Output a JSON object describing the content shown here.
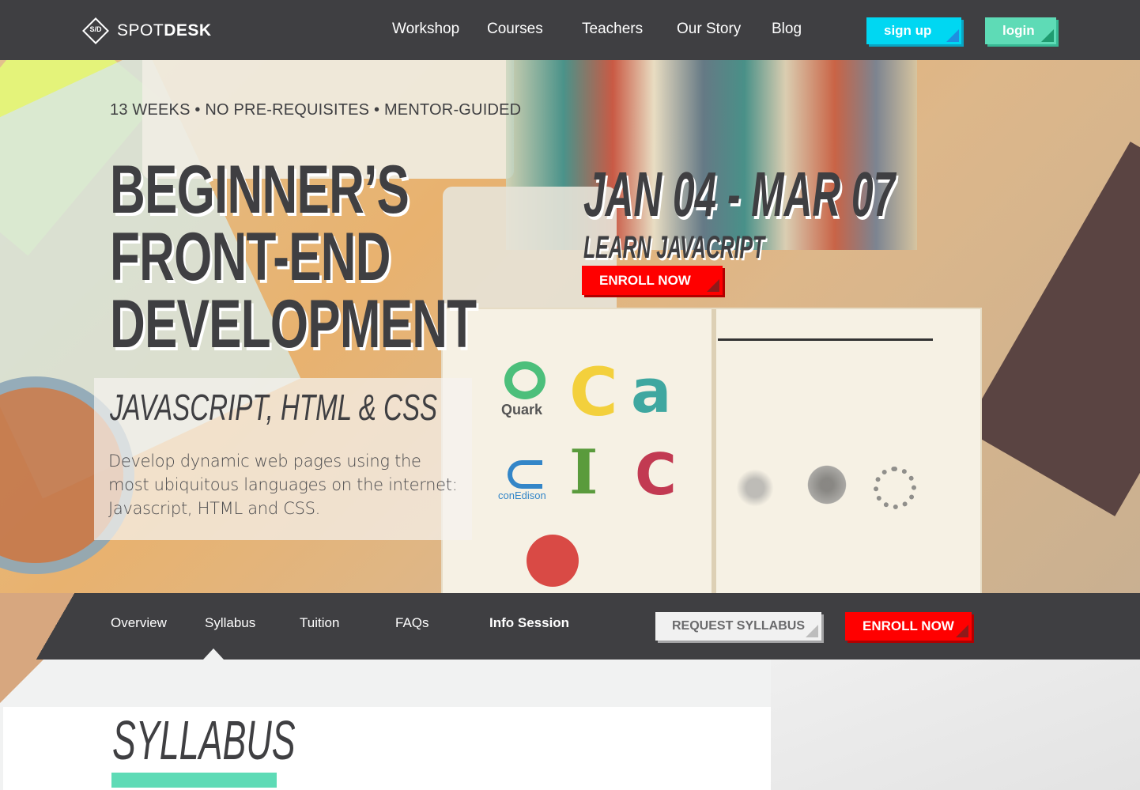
{
  "logo": {
    "mark": "S/D",
    "text_light": "SPOT",
    "text_bold": "DESK"
  },
  "nav": {
    "links": [
      "Workshop",
      "Courses",
      "Teachers",
      "Our Story",
      "Blog"
    ],
    "signup_label": "sign up",
    "login_label": "login"
  },
  "hero": {
    "meta": "13 WEEKS • NO PRE-REQUISITES • MENTOR-GUIDED",
    "title_lines": [
      "BEGINNER’S",
      "FRONT-END",
      "DEVELOPMENT"
    ],
    "subtitle": "JAVASCRIPT, HTML & CSS",
    "description": "Develop dynamic web pages using the most ubiquitous languages on the internet: Javascript, HTML and CSS.",
    "dates": "JAN 04 - MAR 07",
    "learn": "LEARN JAVACRIPT",
    "enroll_label": "ENROLL NOW",
    "photo_text": {
      "quark": "Quark",
      "conedison": "conEdison"
    }
  },
  "subnav": {
    "links": [
      "Overview",
      "Syllabus",
      "Tuition",
      "FAQs"
    ],
    "info_session": "Info Session",
    "request_label": "REQUEST SYLLABUS",
    "enroll_label": "ENROLL NOW"
  },
  "section": {
    "heading": "SYLLABUS"
  },
  "colors": {
    "dark": "#3f3f42",
    "cyan": "#00d7f2",
    "mint": "#5edbb6",
    "red": "#ff0000"
  }
}
